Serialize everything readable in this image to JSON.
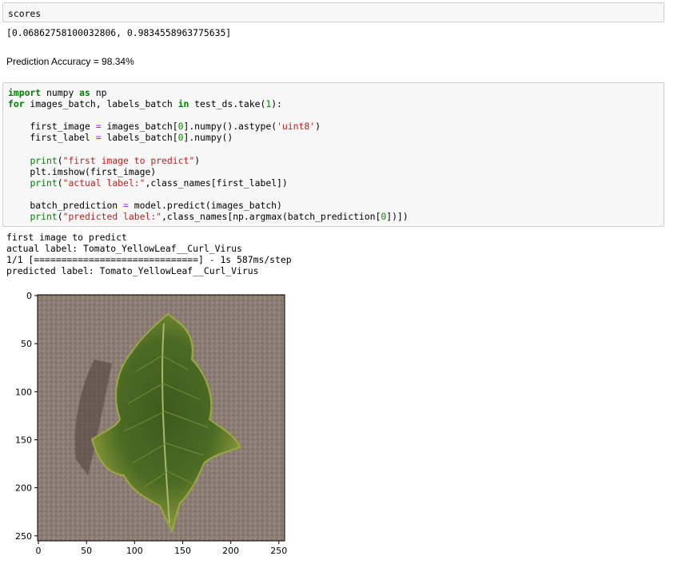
{
  "cell1": {
    "input_code": "scores",
    "output": "[0.06862758100032806, 0.9834558963775635]"
  },
  "cell2_output": "Prediction Accuracy = 98.34%",
  "cell3": {
    "lines": [
      {
        "parts": [
          [
            "kw",
            "import"
          ],
          [
            "t",
            " numpy "
          ],
          [
            "kw",
            "as"
          ],
          [
            "t",
            " np"
          ]
        ]
      },
      {
        "parts": [
          [
            "kw",
            "for"
          ],
          [
            "t",
            " images_batch, labels_batch "
          ],
          [
            "kw",
            "in"
          ],
          [
            "t",
            " test_ds.take("
          ],
          [
            "num",
            "1"
          ],
          [
            "t",
            "):"
          ]
        ]
      },
      {
        "parts": [
          [
            "t",
            ""
          ]
        ]
      },
      {
        "parts": [
          [
            "t",
            "    first_image "
          ],
          [
            "op",
            "="
          ],
          [
            "t",
            " images_batch["
          ],
          [
            "num",
            "0"
          ],
          [
            "t",
            "].numpy().astype("
          ],
          [
            "str",
            "'uint8'"
          ],
          [
            "t",
            ")"
          ]
        ]
      },
      {
        "parts": [
          [
            "t",
            "    first_label "
          ],
          [
            "op",
            "="
          ],
          [
            "t",
            " labels_batch["
          ],
          [
            "num",
            "0"
          ],
          [
            "t",
            "].numpy()"
          ]
        ]
      },
      {
        "parts": [
          [
            "t",
            ""
          ]
        ]
      },
      {
        "parts": [
          [
            "t",
            "    "
          ],
          [
            "fn",
            "print"
          ],
          [
            "t",
            "("
          ],
          [
            "str",
            "\"first image to predict\""
          ],
          [
            "t",
            ")"
          ]
        ]
      },
      {
        "parts": [
          [
            "t",
            "    plt.imshow(first_image)"
          ]
        ]
      },
      {
        "parts": [
          [
            "t",
            "    "
          ],
          [
            "fn",
            "print"
          ],
          [
            "t",
            "("
          ],
          [
            "str",
            "\"actual label:\""
          ],
          [
            "t",
            ",class_names[first_label])"
          ]
        ]
      },
      {
        "parts": [
          [
            "t",
            ""
          ]
        ]
      },
      {
        "parts": [
          [
            "t",
            "    batch_prediction "
          ],
          [
            "op",
            "="
          ],
          [
            "t",
            " model.predict(images_batch)"
          ]
        ]
      },
      {
        "parts": [
          [
            "t",
            "    "
          ],
          [
            "fn",
            "print"
          ],
          [
            "t",
            "("
          ],
          [
            "str",
            "\"predicted label:\""
          ],
          [
            "t",
            ",class_names[np.argmax(batch_prediction["
          ],
          [
            "num",
            "0"
          ],
          [
            "t",
            "])])"
          ]
        ]
      }
    ],
    "output_lines": [
      "first image to predict",
      "actual label: Tomato_YellowLeaf__Curl_Virus",
      "1/1 [==============================] - 1s 587ms/step",
      "predicted label: Tomato_YellowLeaf__Curl_Virus"
    ]
  },
  "plot": {
    "image_subject": "tomato-leaf",
    "x_ticks": [
      "0",
      "50",
      "100",
      "150",
      "200",
      "250"
    ],
    "y_ticks": [
      "0",
      "50",
      "100",
      "150",
      "200",
      "250"
    ],
    "colors": {
      "background": "#8a7a6e",
      "leaf_dark": "#2f4a1a",
      "leaf_mid": "#4f6b25",
      "leaf_light": "#8a9a3a"
    }
  }
}
